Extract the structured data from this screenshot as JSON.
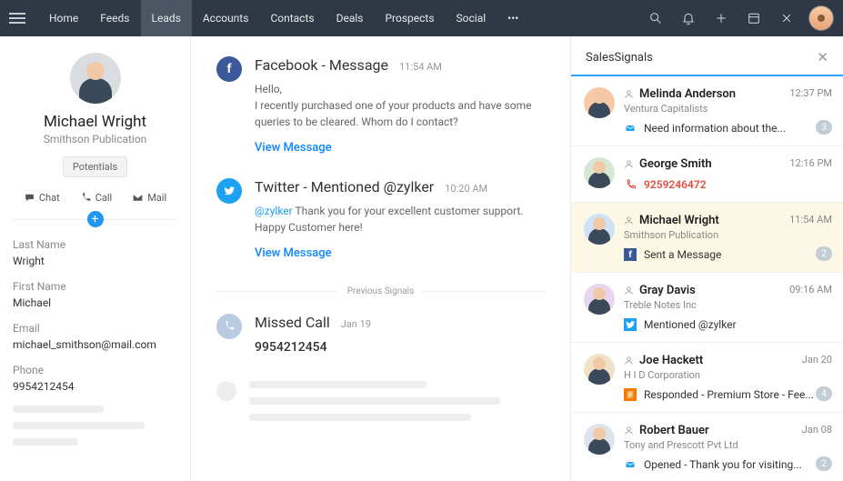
{
  "nav": {
    "items": [
      "Home",
      "Feeds",
      "Leads",
      "Accounts",
      "Contacts",
      "Deals",
      "Prospects",
      "Social"
    ],
    "active": 2,
    "more": "•••"
  },
  "lead": {
    "name": "Michael Wright",
    "org": "Smithson Publication",
    "potentials_label": "Potentials",
    "comm": {
      "chat": "Chat",
      "call": "Call",
      "mail": "Mail"
    },
    "fields": {
      "last_name_label": "Last Name",
      "last_name": "Wright",
      "first_name_label": "First Name",
      "first_name": "Michael",
      "email_label": "Email",
      "email": "michael_smithson@mail.com",
      "phone_label": "Phone",
      "phone": "9954212454"
    }
  },
  "feed": {
    "fb": {
      "title": "Facebook - Message",
      "time": "11:54 AM",
      "l1": "Hello,",
      "l2": "I recently purchased one of your products and have some queries to be cleared. Whom do I contact?",
      "view": "View Message"
    },
    "tw": {
      "title": "Twitter - Mentioned @zylker",
      "time": "10:20 AM",
      "mention": "@zylker",
      "msg": " Thank you for your excellent customer support. Happy Customer here!",
      "view": "View Message"
    },
    "divider": "Previous Signals",
    "call": {
      "title": "Missed Call",
      "time": "Jan 19",
      "num": "9954212454"
    }
  },
  "panel": {
    "title": "SalesSignals",
    "items": [
      {
        "name": "Melinda Anderson",
        "co": "Ventura Capitalists",
        "time": "12:37 PM",
        "icon": "env",
        "text": "Need information about the...",
        "badge": "3"
      },
      {
        "name": "George Smith",
        "time": "12:16 PM",
        "icon": "phone",
        "text": "9259246472"
      },
      {
        "name": "Michael Wright",
        "co": "Smithson Publication",
        "time": "11:54 AM",
        "icon": "fb",
        "text": "Sent a Message",
        "badge": "2"
      },
      {
        "name": "Gray Davis",
        "co": "Treble Notes Inc",
        "time": "09:16 AM",
        "icon": "tw",
        "text": "Mentioned @zylker"
      },
      {
        "name": "Joe Hackett",
        "co": "H I D Corporation",
        "time": "Jan 20",
        "icon": "form",
        "text": "Responded - Premium Store - Fee...",
        "badge": "4"
      },
      {
        "name": "Robert Bauer",
        "co": "Tony and Prescott Pvt Ltd",
        "time": "Jan 08",
        "icon": "env",
        "text": "Opened - Thank you for visiting...",
        "badge": "2"
      }
    ]
  }
}
